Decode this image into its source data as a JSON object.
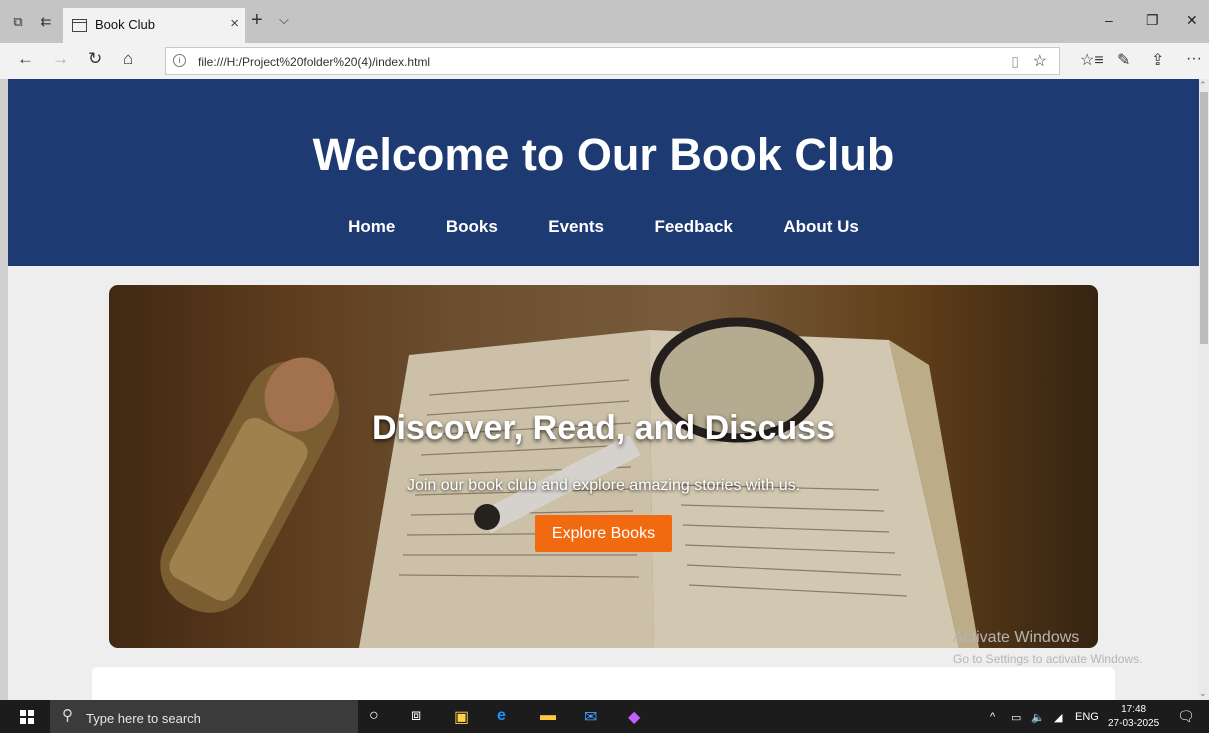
{
  "browser": {
    "tab_title": "Book Club",
    "url": "file:///H:/Project%20folder%20(4)/index.html",
    "icons": {
      "tab_close": "×",
      "new_tab": "+",
      "tab_dropdown": "⌵",
      "minimize": "–",
      "restore": "❐",
      "window_close": "✕",
      "back": "←",
      "forward": "→",
      "refresh": "↻",
      "home": "⌂",
      "site_info": "i",
      "reading_view": "▯",
      "favorite": "☆",
      "favorites_hub": "☆≡",
      "notes": "✎",
      "share": "⇪",
      "more": "···"
    }
  },
  "site": {
    "title": "Welcome to Our Book Club",
    "nav": [
      "Home",
      "Books",
      "Events",
      "Feedback",
      "About Us"
    ],
    "hero": {
      "heading": "Discover, Read, and Discuss",
      "text": "Join our book club and explore amazing stories with us.",
      "button": "Explore Books"
    },
    "colors": {
      "header_bg": "#1e3a72",
      "button_bg": "#f26a0f"
    }
  },
  "watermark": {
    "line1": "Activate Windows",
    "line2": "Go to Settings to activate Windows."
  },
  "taskbar": {
    "search_placeholder": "Type here to search",
    "language": "ENG",
    "time": "17:48",
    "date": "27-03-2025"
  }
}
